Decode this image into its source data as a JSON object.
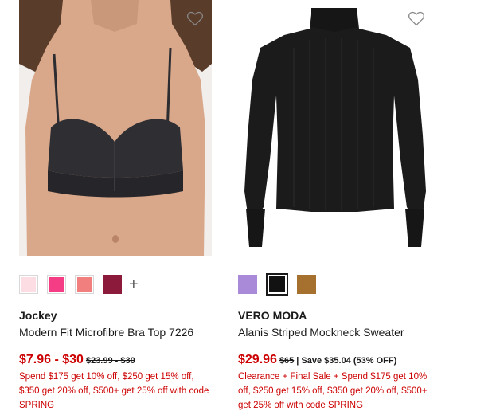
{
  "products": [
    {
      "brand": "Jockey",
      "name": "Modern Fit Microfibre Bra Top 7226",
      "sale_price": "$7.96 - $30",
      "original_price": "$23.99 - $30",
      "promo": "Spend $175 get 10% off, $250 get 15% off, $350 get 20% off, $500+ get 25% off with code SPRING",
      "wishlist_icon": "heart-outline-icon",
      "swatches": [
        {
          "color": "#fbdde3",
          "selected": false
        },
        {
          "color": "#f43d84",
          "selected": false
        },
        {
          "color": "#f07f7e",
          "selected": false
        },
        {
          "color": "#8b1a3b",
          "selected": false
        }
      ],
      "more_colors_symbol": "+"
    },
    {
      "brand": "VERO MODA",
      "name": "Alanis Striped Mockneck Sweater",
      "sale_price": "$29.96",
      "original_price": "$65",
      "savings": "| Save $35.04 (53% OFF)",
      "promo": "Clearance + Final Sale + Spend $175 get 10% off, $250 get 15% off, $350 get 20% off, $500+ get 25% off with code SPRING",
      "wishlist_icon": "heart-outline-icon",
      "swatches": [
        {
          "color": "#a98ad8",
          "selected": false
        },
        {
          "color": "#121212",
          "selected": true
        },
        {
          "color": "#a6702e",
          "selected": false
        }
      ]
    }
  ],
  "colors": {
    "sale_red": "#cc0000",
    "text": "#1a1a1a"
  }
}
